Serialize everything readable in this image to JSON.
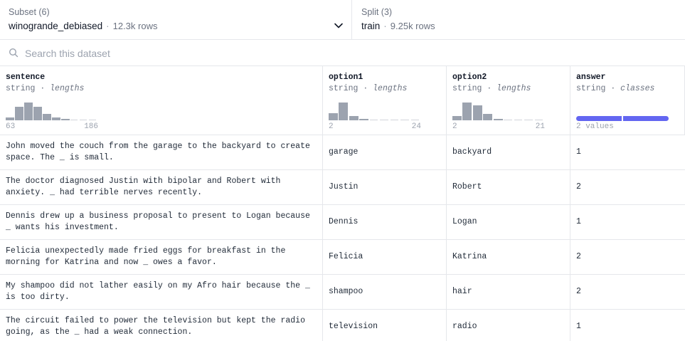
{
  "subset": {
    "label": "Subset (6)",
    "value": "winogrande_debiased",
    "rows": "12.3k rows"
  },
  "split": {
    "label": "Split (3)",
    "value": "train",
    "rows": "9.25k rows"
  },
  "search": {
    "placeholder": "Search this dataset"
  },
  "columns": [
    {
      "name": "sentence",
      "type": "string",
      "stat": "lengths",
      "min": "63",
      "max": "186",
      "hist": [
        0.15,
        0.65,
        0.85,
        0.65,
        0.3,
        0.12,
        0.05,
        0,
        0,
        0
      ]
    },
    {
      "name": "option1",
      "type": "string",
      "stat": "lengths",
      "min": "2",
      "max": "24",
      "hist": [
        0.35,
        0.85,
        0.2,
        0.05,
        0,
        0,
        0,
        0,
        0
      ]
    },
    {
      "name": "option2",
      "type": "string",
      "stat": "lengths",
      "min": "2",
      "max": "21",
      "hist": [
        0.2,
        0.85,
        0.7,
        0.3,
        0.08,
        0,
        0,
        0,
        0
      ]
    },
    {
      "name": "answer",
      "type": "string",
      "stat": "classes",
      "summary": "2 values",
      "classes": [
        0.5,
        0.5
      ]
    }
  ],
  "rows": [
    {
      "sentence": "John moved the couch from the garage to the backyard to create space. The _ is small.",
      "option1": "garage",
      "option2": "backyard",
      "answer": "1"
    },
    {
      "sentence": "The doctor diagnosed Justin with bipolar and Robert with anxiety. _ had terrible nerves recently.",
      "option1": "Justin",
      "option2": "Robert",
      "answer": "2"
    },
    {
      "sentence": "Dennis drew up a business proposal to present to Logan because _ wants his investment.",
      "option1": "Dennis",
      "option2": "Logan",
      "answer": "1"
    },
    {
      "sentence": "Felicia unexpectedly made fried eggs for breakfast in the morning for Katrina and now _ owes a favor.",
      "option1": "Felicia",
      "option2": "Katrina",
      "answer": "2"
    },
    {
      "sentence": "My shampoo did not lather easily on my Afro hair because the _ is too dirty.",
      "option1": "shampoo",
      "option2": "hair",
      "answer": "2"
    },
    {
      "sentence": "The circuit failed to power the television but kept the radio going, as the _ had a weak connection.",
      "option1": "television",
      "option2": "radio",
      "answer": "1"
    }
  ],
  "colors": {
    "accent": "#6366f1",
    "hist": "#9ca3af",
    "border": "#e5e7eb"
  },
  "icons": {
    "search": "search-icon",
    "dropdown": "chevron-down-icon"
  }
}
